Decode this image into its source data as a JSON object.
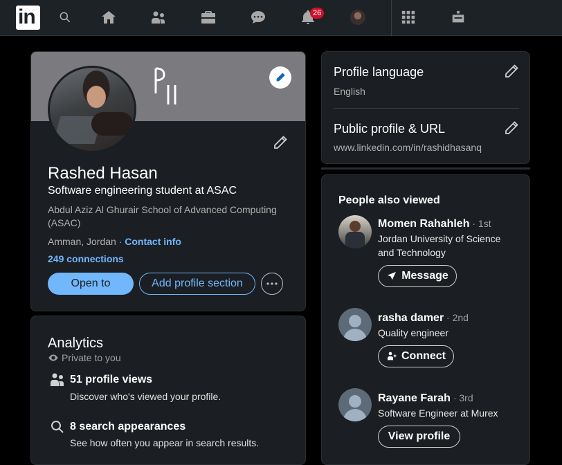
{
  "nav": {
    "logo_text": "in",
    "notifications_count": "26",
    "icons": [
      "search-icon",
      "home-icon",
      "my-network-icon",
      "jobs-icon",
      "messaging-icon",
      "notifications-icon",
      "me-avatar",
      "work-grid-icon",
      "advertise-icon"
    ]
  },
  "profile": {
    "name": "Rashed Hasan",
    "headline": "Software engineering student at ASAC",
    "school": "Abdul Aziz Al Ghurair School of Advanced Computing (ASAC)",
    "location": "Amman, Jordan · ",
    "contact_info": "Contact info",
    "connections": "249 connections",
    "open_to_label": "Open to",
    "add_section_label": "Add profile section",
    "more_label": "···"
  },
  "analytics": {
    "title": "Analytics",
    "privacy": "Private to you",
    "items": [
      {
        "title": "51 profile views",
        "desc": "Discover who's viewed your profile."
      },
      {
        "title": "8 search appearances",
        "desc": "See how often you appear in search results."
      }
    ]
  },
  "settings": {
    "language_title": "Profile language",
    "language_value": "English",
    "url_title": "Public profile & URL",
    "url_value": "www.linkedin.com/in/rashidhasanq"
  },
  "people_also_viewed": {
    "title": "People also viewed",
    "people": [
      {
        "name": "Momen Rahahleh",
        "degree": " · 1st",
        "desc": "Jordan University of Science and Technology",
        "action": "Message"
      },
      {
        "name": "rasha damer",
        "degree": " · 2nd",
        "desc": "Quality engineer",
        "action": "Connect"
      },
      {
        "name": "Rayane Farah",
        "degree": " · 3rd",
        "desc": "Software Engineer at Murex",
        "action": "View profile"
      }
    ]
  },
  "colors": {
    "accent": "#71b7fb",
    "badge": "#cb112d",
    "card": "#1b1f23",
    "nav": "#1d2226"
  }
}
